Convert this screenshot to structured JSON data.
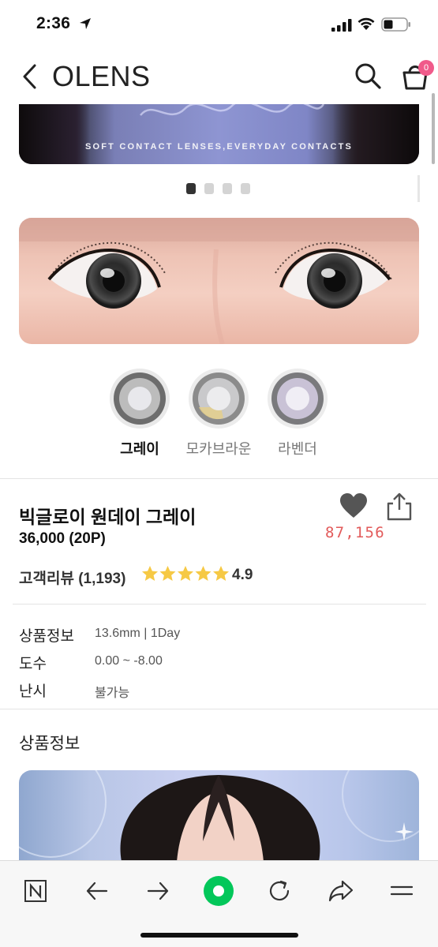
{
  "status_bar": {
    "time": "2:36"
  },
  "header": {
    "brand": "OLENS",
    "cart_count": "0"
  },
  "banner": {
    "caption": "SOFT CONTACT LENSES,EVERYDAY CONTACTS",
    "page_count": 4,
    "active_page": 1
  },
  "colors": {
    "options": [
      {
        "label": "그레이",
        "selected": true
      },
      {
        "label": "모카브라운",
        "selected": false
      },
      {
        "label": "라벤더",
        "selected": false
      }
    ]
  },
  "product": {
    "name": "빅글로이 원데이 그레이",
    "price": "36,000 (20P)",
    "likes": "87,156",
    "review_label": "고객리뷰 (1,193)",
    "rating": "4.9",
    "rating_stars": 5
  },
  "specs": [
    {
      "label": "상품정보",
      "value": "13.6mm | 1Day"
    },
    {
      "label": "도수",
      "value": "0.00 ~ -8.00"
    },
    {
      "label": "난시",
      "value": "불가능"
    }
  ],
  "section": {
    "title": "상품정보"
  },
  "accent_colors": {
    "badge": "#f05a8a",
    "likes": "#e25a5a",
    "stars": "#f6c945",
    "home_button": "#03c75a"
  }
}
